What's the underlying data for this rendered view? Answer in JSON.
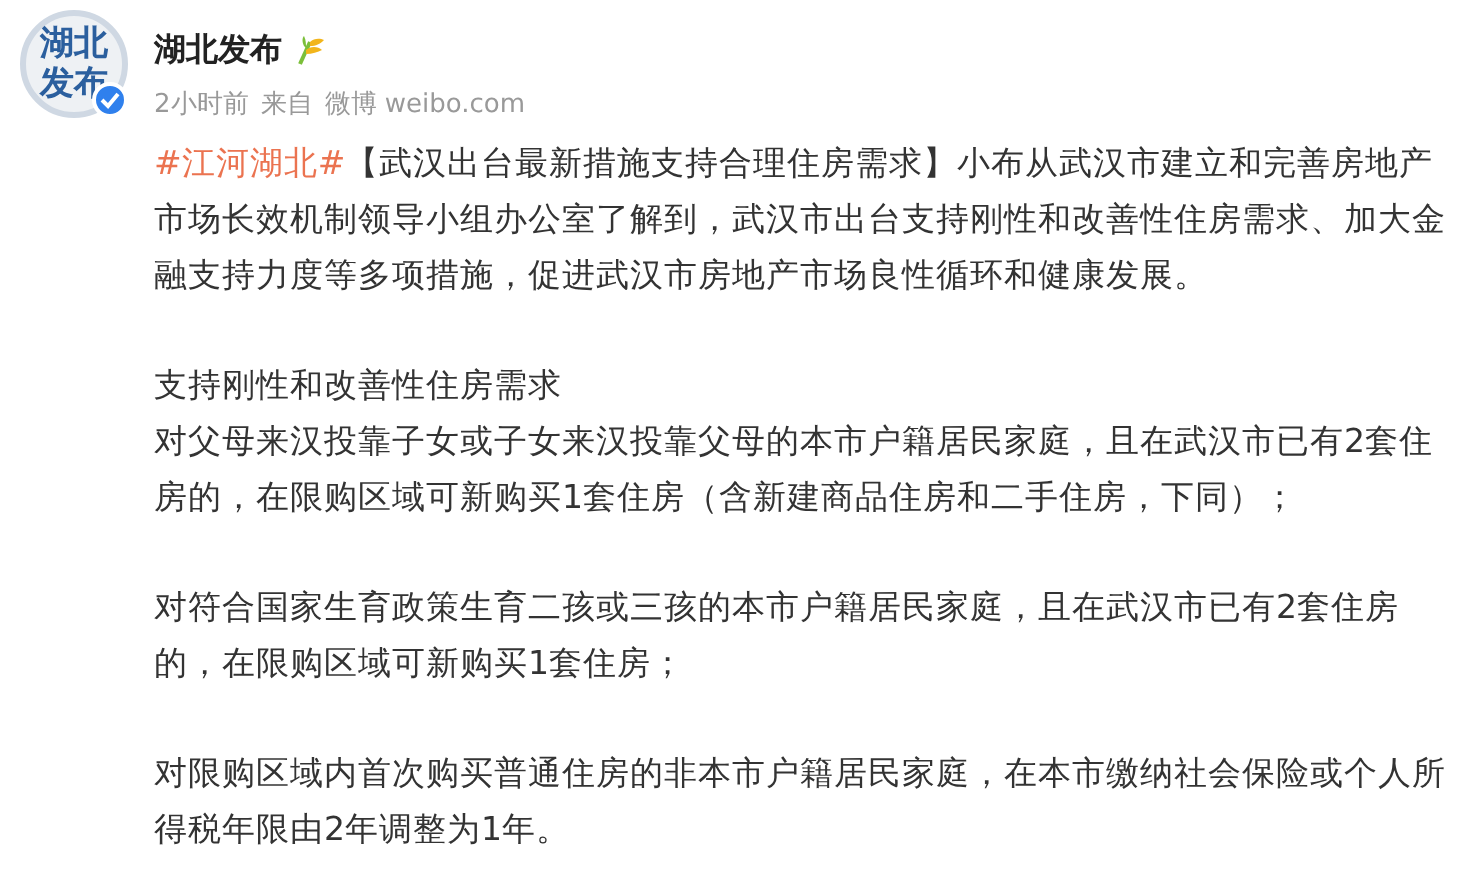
{
  "author": {
    "name": "湖北发布",
    "avatar_text": [
      "湖北",
      "发布"
    ],
    "verified": true
  },
  "meta": {
    "time": "2小时前",
    "source_label": "来自",
    "source": "微博 weibo.com"
  },
  "post": {
    "hashtag": "#江河湖北#",
    "blocks": [
      [
        "【武汉出台最新措施支持合理住房需求】小布从武汉市建立和完善房地产市场长效机制领导小组办公室了解到，武汉市出台支持刚性和改善性住房需求、加大金融支持力度等多项措施，促进武汉市房地产市场良性循环和健康发展。"
      ],
      [
        "支持刚性和改善性住房需求",
        "对父母来汉投靠子女或子女来汉投靠父母的本市户籍居民家庭，且在武汉市已有2套住房的，在限购区域可新购买1套住房（含新建商品住房和二手住房，下同）；"
      ],
      [
        "对符合国家生育政策生育二孩或三孩的本市户籍居民家庭，且在武汉市已有2套住房的，在限购区域可新购买1套住房；"
      ],
      [
        "对限购区域内首次购买普通住房的非本市户籍居民家庭，在本市缴纳社会保险或个人所得税年限由2年调整为1年。"
      ]
    ]
  }
}
